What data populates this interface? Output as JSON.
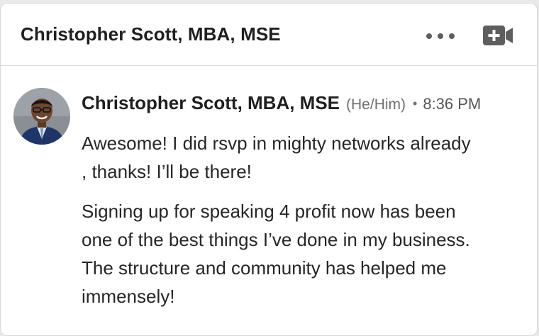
{
  "conversation": {
    "title": "Christopher Scott, MBA, MSE",
    "more_icon": "more-horizontal-icon",
    "video_icon": "video-call-icon"
  },
  "message": {
    "sender": "Christopher Scott, MBA, MSE",
    "pronouns": "(He/Him)",
    "separator": "•",
    "time": "8:36 PM",
    "paragraphs": [
      "Awesome! I did rsvp in mighty networks already , thanks! I’ll be there!",
      "Signing up for speaking 4 profit now has been one of the best things I’ve done in my business. The structure and community has helped me immensely!"
    ]
  },
  "colors": {
    "text": "#1f1f1f",
    "muted": "#6e6e6e",
    "icon": "#5e5e5e"
  }
}
